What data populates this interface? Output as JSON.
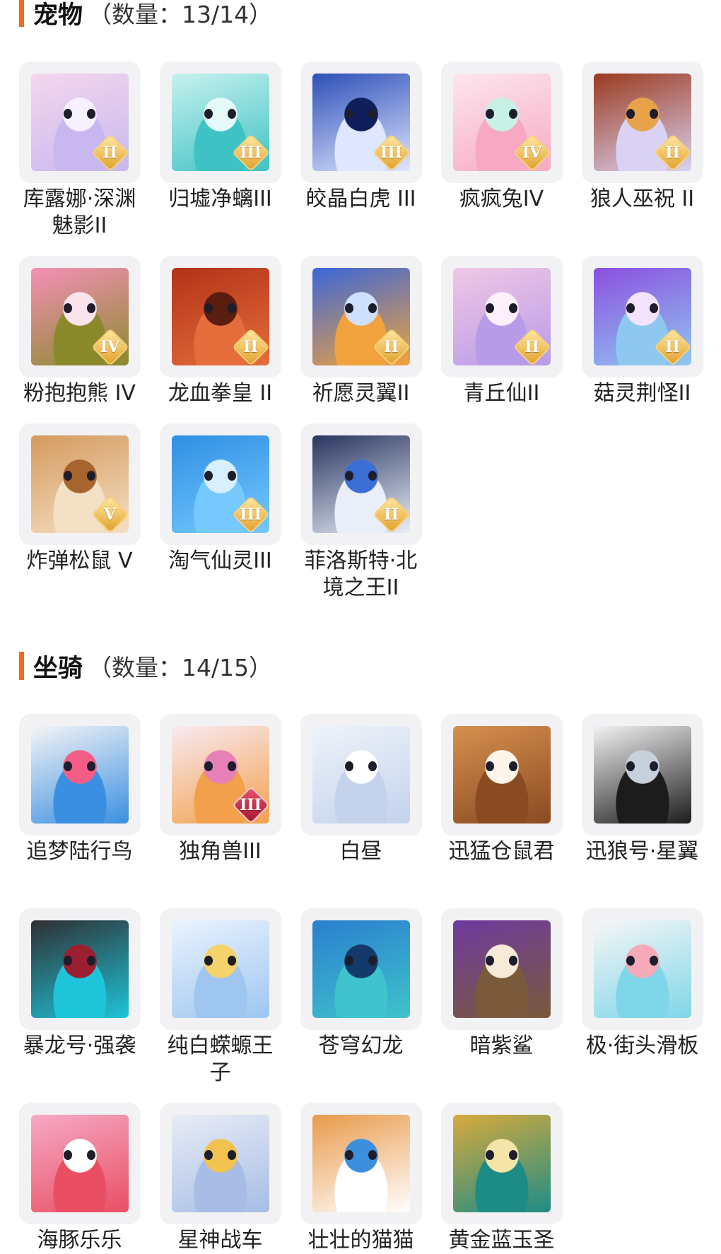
{
  "pets": {
    "title": "宠物",
    "count": "（数量：13/14）",
    "items": [
      {
        "name": "库露娜·深渊魅影II",
        "badge": "II",
        "colors": [
          "#f4d6ee",
          "#c9b8ef",
          "#f7f0ff"
        ]
      },
      {
        "name": "归墟净螭III",
        "badge": "III",
        "colors": [
          "#c7f1ef",
          "#3fc2c4",
          "#e5fbfa"
        ]
      },
      {
        "name": "皎晶白虎 III",
        "badge": "III",
        "colors": [
          "#2d4fb8",
          "#dfe6ff",
          "#101e5c"
        ]
      },
      {
        "name": "疯疯兔IV",
        "badge": "IV",
        "colors": [
          "#fde6ee",
          "#f7a9c4",
          "#c8f1e6"
        ]
      },
      {
        "name": "狼人巫祝 II",
        "badge": "II",
        "colors": [
          "#9b3a1e",
          "#d9d2f2",
          "#e8a24a"
        ]
      },
      {
        "name": "粉抱抱熊 IV",
        "badge": "IV",
        "colors": [
          "#f590b7",
          "#8a8a2c",
          "#fbe3ec"
        ]
      },
      {
        "name": "龙血拳皇 II",
        "badge": "II",
        "colors": [
          "#b23318",
          "#e56d3b",
          "#5a1e10"
        ]
      },
      {
        "name": "祈愿灵翼II",
        "badge": "II",
        "colors": [
          "#3a66d9",
          "#f2a23d",
          "#cfe0ff"
        ]
      },
      {
        "name": "青丘仙II",
        "badge": "II",
        "colors": [
          "#f0c7e5",
          "#b89be8",
          "#fff0fb"
        ]
      },
      {
        "name": "菇灵荆怪II",
        "badge": "II",
        "colors": [
          "#8c4fe0",
          "#8ec8f0",
          "#f4e3ff"
        ]
      },
      {
        "name": "炸弹松鼠 V",
        "badge": "V",
        "colors": [
          "#d59a5e",
          "#f4e0c4",
          "#a7642e"
        ]
      },
      {
        "name": "淘气仙灵III",
        "badge": "III",
        "colors": [
          "#2f8fe3",
          "#75c9ff",
          "#d7efff"
        ]
      },
      {
        "name": "菲洛斯特·北境之王II",
        "badge": "II",
        "colors": [
          "#28345f",
          "#e9eef8",
          "#3b6fd6"
        ]
      }
    ]
  },
  "mounts": {
    "title": "坐骑",
    "count": "（数量：14/15）",
    "items": [
      {
        "name": "追梦陆行鸟",
        "badge": "",
        "colors": [
          "#f4f4f6",
          "#3a8fe0",
          "#f55d86"
        ]
      },
      {
        "name": "独角兽III",
        "badge": "III",
        "colors": [
          "#f8eaf2",
          "#f3a04d",
          "#e780b6"
        ]
      },
      {
        "name": "白昼",
        "badge": "",
        "colors": [
          "#eef3fa",
          "#c4d2ec",
          "#ffffff"
        ]
      },
      {
        "name": "迅猛仓鼠君",
        "badge": "",
        "colors": [
          "#d6904e",
          "#8a4a22",
          "#fff5ea"
        ]
      },
      {
        "name": "迅狼号·星翼",
        "badge": "",
        "colors": [
          "#f2f2f4",
          "#1c1c1c",
          "#c7d1dc"
        ]
      },
      {
        "name": "暴龙号·强袭",
        "badge": "",
        "colors": [
          "#2f2f33",
          "#1ec4d8",
          "#9a1f30"
        ]
      },
      {
        "name": "纯白蝾螈王子",
        "badge": "",
        "colors": [
          "#eaf3ff",
          "#9ec6f0",
          "#f5d36a"
        ]
      },
      {
        "name": "苍穹幻龙",
        "badge": "",
        "colors": [
          "#2a7fce",
          "#3fc3cc",
          "#143a6b"
        ]
      },
      {
        "name": "暗紫鲨",
        "badge": "",
        "colors": [
          "#6e3aa0",
          "#7a5a3a",
          "#f7ead6"
        ]
      },
      {
        "name": "极·街头滑板",
        "badge": "",
        "colors": [
          "#f6f6f6",
          "#7fd6e8",
          "#f4aab8"
        ]
      },
      {
        "name": "海豚乐乐",
        "badge": "",
        "colors": [
          "#f6a9c6",
          "#e94f63",
          "#ffffff"
        ]
      },
      {
        "name": "星神战车",
        "badge": "",
        "colors": [
          "#e8ecf6",
          "#a7bde6",
          "#f2c24f"
        ]
      },
      {
        "name": "壮壮的猫猫",
        "badge": "",
        "colors": [
          "#e99a4a",
          "#ffffff",
          "#3b8fdc"
        ]
      },
      {
        "name": "黄金蓝玉圣",
        "badge": "",
        "colors": [
          "#d8aa3c",
          "#1e8c86",
          "#f5e4a8"
        ]
      }
    ]
  },
  "accent_color": "#f26b21"
}
